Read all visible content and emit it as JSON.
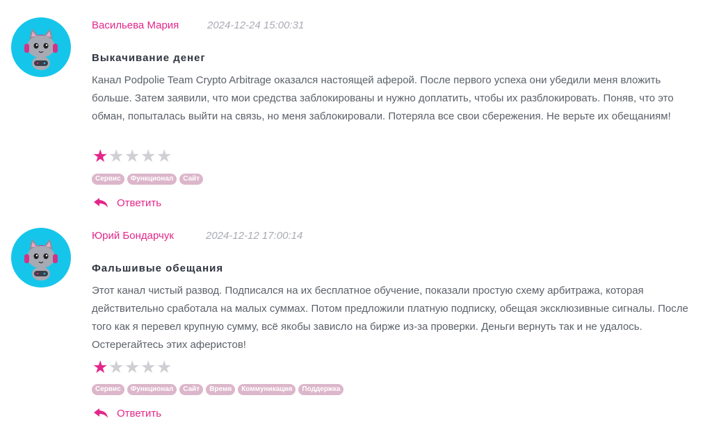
{
  "reviews": [
    {
      "author": "Васильева Мария",
      "date": "2024-12-24 15:00:31",
      "title": "Выкачивание денег",
      "text": "Канал Podpolie Team Crypto Arbitrage оказался настоящей аферой. После первого успеха они убедили меня вложить больше. Затем заявили, что мои средства заблокированы и нужно доплатить, чтобы их разблокировать. Поняв, что это обман, попыталась выйти на связь, но меня заблокировали. Потеряла все свои сбережения. Не верьте их обещаниям!",
      "rating": 1,
      "rating_max": 5,
      "tags": [
        "Сервис",
        "Функционал",
        "Сайт"
      ],
      "reply_label": "Ответить",
      "avatar_icon": "cat-gamer-avatar-icon"
    },
    {
      "author": "Юрий Бондарчук",
      "date": "2024-12-12 17:00:14",
      "title": "Фальшивые обещания",
      "text": "Этот канал чистый развод. Подписался на их бесплатное обучение, показали простую схему арбитража, которая действительно сработала на малых суммах. Потом предложили платную подписку, обещая эксклюзивные сигналы. После того как я перевел крупную сумму, всё якобы зависло на бирже из-за проверки. Деньги вернуть так и не удалось. Остерегайтесь этих аферистов!",
      "rating": 1,
      "rating_max": 5,
      "tags": [
        "Сервис",
        "Функционал",
        "Сайт",
        "Время",
        "Коммуникация",
        "Поддержка"
      ],
      "reply_label": "Ответить",
      "avatar_icon": "cat-gamer-avatar-icon"
    }
  ],
  "colors": {
    "accent": "#e3268a",
    "avatar_bg": "#15c6ea",
    "tag_bg": "#dcb6ca",
    "star_off": "#cfcfd4"
  }
}
